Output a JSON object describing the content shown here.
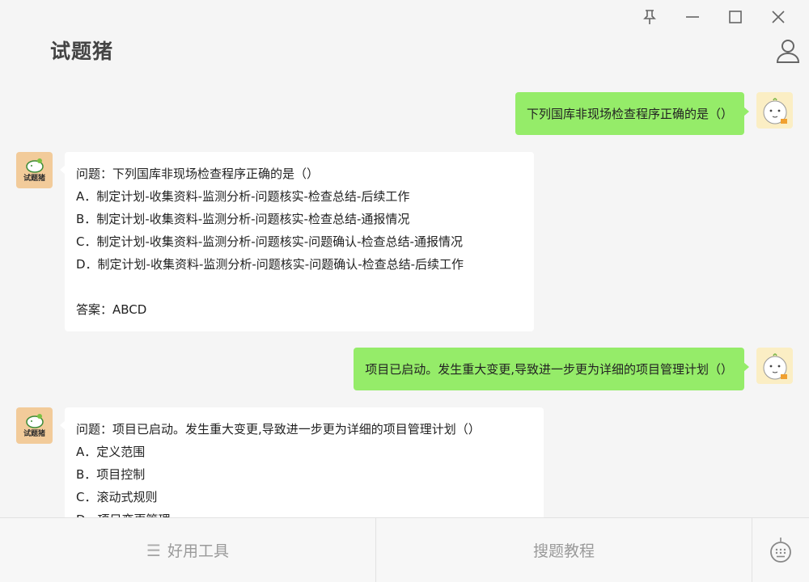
{
  "app": {
    "title": "试题猪"
  },
  "window_controls": {
    "pin": "pin-icon",
    "minimize": "minimize-icon",
    "maximize": "maximize-icon",
    "close": "close-icon"
  },
  "bot_avatar": {
    "label": "试题猪"
  },
  "messages": [
    {
      "role": "user",
      "text": "下列国库非现场检查程序正确的是（）"
    },
    {
      "role": "bot",
      "question": "问题：下列国库非现场检查程序正确的是（）",
      "options": [
        "A．制定计划-收集资料-监测分析-问题核实-检查总结-后续工作",
        "B．制定计划-收集资料-监测分析-问题核实-检查总结-通报情况",
        "C．制定计划-收集资料-监测分析-问题核实-问题确认-检查总结-通报情况",
        "D．制定计划-收集资料-监测分析-问题核实-问题确认-检查总结-后续工作"
      ],
      "answer": "答案：ABCD"
    },
    {
      "role": "user",
      "text": "项目已启动。发生重大变更,导致进一步更为详细的项目管理计划（）"
    },
    {
      "role": "bot",
      "question": "问题：项目已启动。发生重大变更,导致进一步更为详细的项目管理计划（）",
      "options": [
        "A．定义范围",
        "B．项目控制",
        "C．滚动式规则",
        "D．项目变更管理"
      ]
    }
  ],
  "bottom_bar": {
    "tools_label": "好用工具",
    "tutorial_label": "搜题教程",
    "keyboard_icon": "keyboard-icon"
  },
  "colors": {
    "user_bubble": "#95ec69",
    "bot_bubble": "#ffffff",
    "background": "#f5f5f5"
  }
}
